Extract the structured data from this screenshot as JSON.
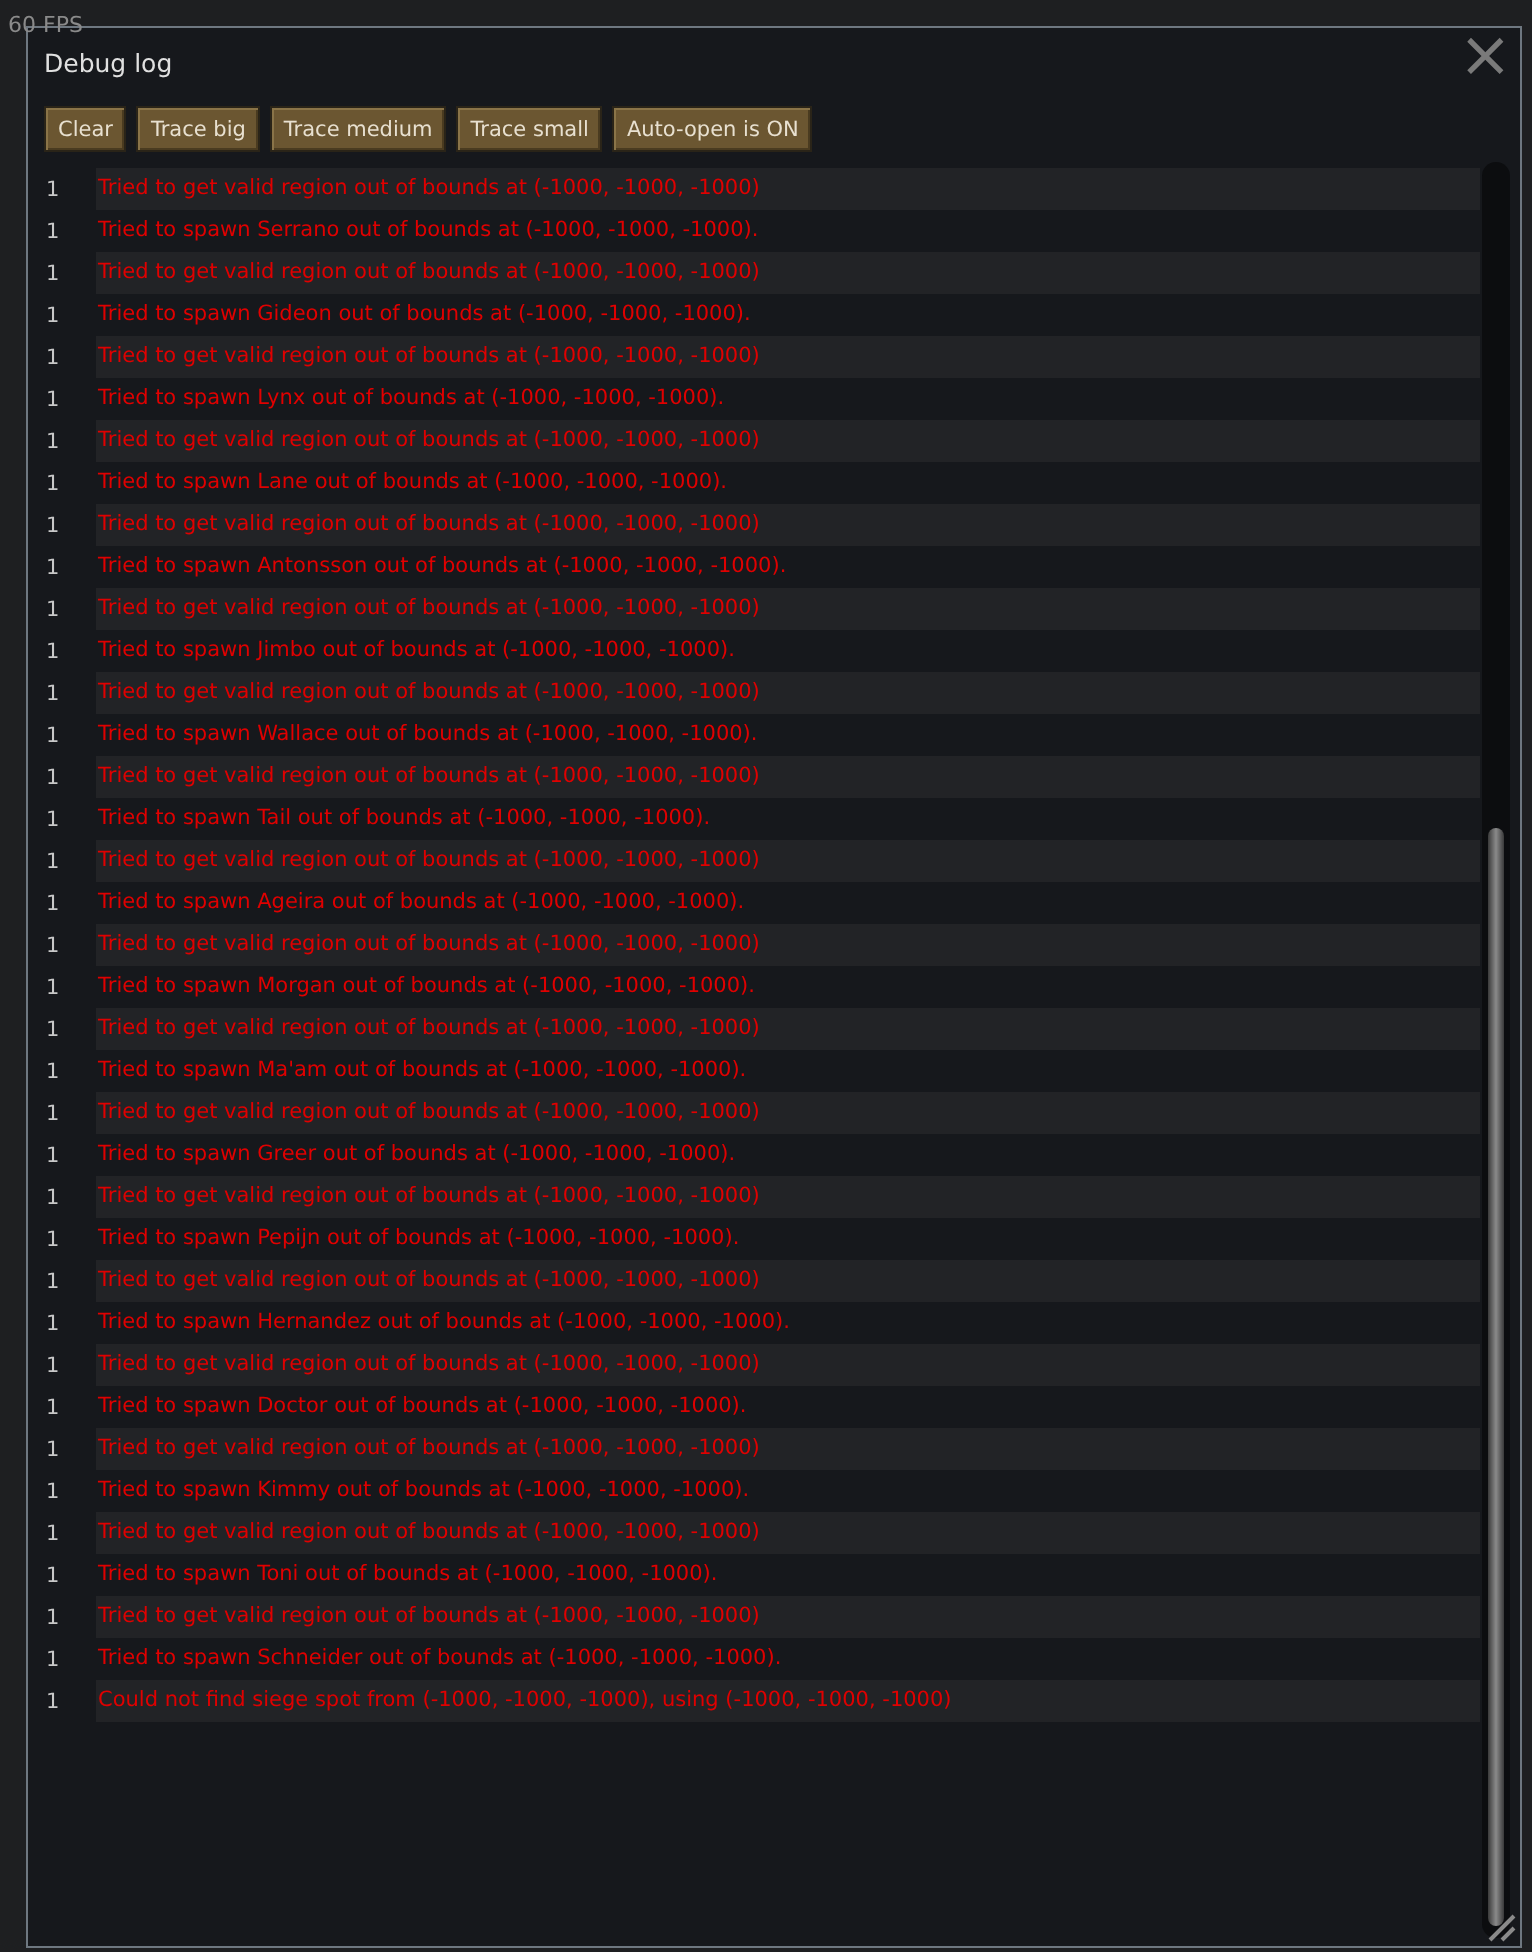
{
  "fps_counter": "60 FPS",
  "window": {
    "title": "Debug log",
    "close_icon": "×"
  },
  "buttons": [
    {
      "label": "Clear"
    },
    {
      "label": "Trace big"
    },
    {
      "label": "Trace medium"
    },
    {
      "label": "Trace small"
    },
    {
      "label": "Auto-open is ON"
    }
  ],
  "log": [
    {
      "count": "1",
      "message": "Tried to get valid region out of bounds at (-1000, -1000, -1000)"
    },
    {
      "count": "1",
      "message": "Tried to spawn Serrano out of bounds at (-1000, -1000, -1000)."
    },
    {
      "count": "1",
      "message": "Tried to get valid region out of bounds at (-1000, -1000, -1000)"
    },
    {
      "count": "1",
      "message": "Tried to spawn Gideon out of bounds at (-1000, -1000, -1000)."
    },
    {
      "count": "1",
      "message": "Tried to get valid region out of bounds at (-1000, -1000, -1000)"
    },
    {
      "count": "1",
      "message": "Tried to spawn Lynx out of bounds at (-1000, -1000, -1000)."
    },
    {
      "count": "1",
      "message": "Tried to get valid region out of bounds at (-1000, -1000, -1000)"
    },
    {
      "count": "1",
      "message": "Tried to spawn Lane out of bounds at (-1000, -1000, -1000)."
    },
    {
      "count": "1",
      "message": "Tried to get valid region out of bounds at (-1000, -1000, -1000)"
    },
    {
      "count": "1",
      "message": "Tried to spawn Antonsson out of bounds at (-1000, -1000, -1000)."
    },
    {
      "count": "1",
      "message": "Tried to get valid region out of bounds at (-1000, -1000, -1000)"
    },
    {
      "count": "1",
      "message": "Tried to spawn Jimbo out of bounds at (-1000, -1000, -1000)."
    },
    {
      "count": "1",
      "message": "Tried to get valid region out of bounds at (-1000, -1000, -1000)"
    },
    {
      "count": "1",
      "message": "Tried to spawn Wallace out of bounds at (-1000, -1000, -1000)."
    },
    {
      "count": "1",
      "message": "Tried to get valid region out of bounds at (-1000, -1000, -1000)"
    },
    {
      "count": "1",
      "message": "Tried to spawn Tail out of bounds at (-1000, -1000, -1000)."
    },
    {
      "count": "1",
      "message": "Tried to get valid region out of bounds at (-1000, -1000, -1000)"
    },
    {
      "count": "1",
      "message": "Tried to spawn Ageira out of bounds at (-1000, -1000, -1000)."
    },
    {
      "count": "1",
      "message": "Tried to get valid region out of bounds at (-1000, -1000, -1000)"
    },
    {
      "count": "1",
      "message": "Tried to spawn Morgan out of bounds at (-1000, -1000, -1000)."
    },
    {
      "count": "1",
      "message": "Tried to get valid region out of bounds at (-1000, -1000, -1000)"
    },
    {
      "count": "1",
      "message": "Tried to spawn Ma'am out of bounds at (-1000, -1000, -1000)."
    },
    {
      "count": "1",
      "message": "Tried to get valid region out of bounds at (-1000, -1000, -1000)"
    },
    {
      "count": "1",
      "message": "Tried to spawn Greer out of bounds at (-1000, -1000, -1000)."
    },
    {
      "count": "1",
      "message": "Tried to get valid region out of bounds at (-1000, -1000, -1000)"
    },
    {
      "count": "1",
      "message": "Tried to spawn Pepijn out of bounds at (-1000, -1000, -1000)."
    },
    {
      "count": "1",
      "message": "Tried to get valid region out of bounds at (-1000, -1000, -1000)"
    },
    {
      "count": "1",
      "message": "Tried to spawn Hernandez out of bounds at (-1000, -1000, -1000)."
    },
    {
      "count": "1",
      "message": "Tried to get valid region out of bounds at (-1000, -1000, -1000)"
    },
    {
      "count": "1",
      "message": "Tried to spawn Doctor out of bounds at (-1000, -1000, -1000)."
    },
    {
      "count": "1",
      "message": "Tried to get valid region out of bounds at (-1000, -1000, -1000)"
    },
    {
      "count": "1",
      "message": "Tried to spawn Kimmy out of bounds at (-1000, -1000, -1000)."
    },
    {
      "count": "1",
      "message": "Tried to get valid region out of bounds at (-1000, -1000, -1000)"
    },
    {
      "count": "1",
      "message": "Tried to spawn Toni out of bounds at (-1000, -1000, -1000)."
    },
    {
      "count": "1",
      "message": "Tried to get valid region out of bounds at (-1000, -1000, -1000)"
    },
    {
      "count": "1",
      "message": "Tried to spawn Schneider out of bounds at (-1000, -1000, -1000)."
    },
    {
      "count": "1",
      "message": "Could not find siege spot from (-1000, -1000, -1000), using (-1000, -1000, -1000)"
    }
  ]
}
